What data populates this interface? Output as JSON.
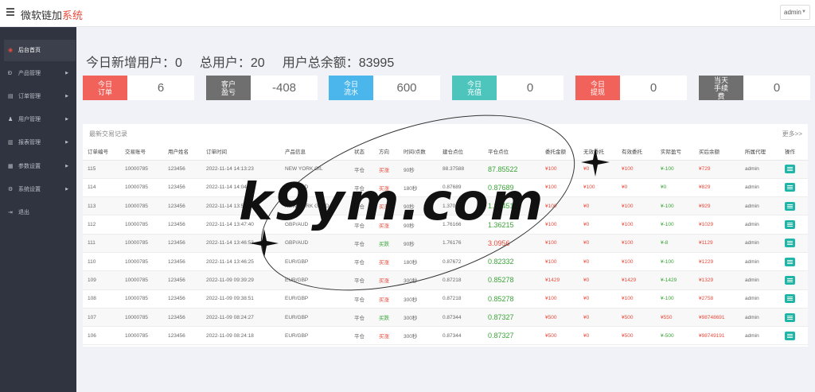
{
  "app": {
    "brand_main": "微软链加",
    "brand_accent": "系统",
    "user_menu": "admin"
  },
  "sidebar": {
    "items": [
      {
        "label": "后台首页",
        "icon": "dashboard-icon",
        "active": true
      },
      {
        "label": "产品管理",
        "icon": "product-icon"
      },
      {
        "label": "订单管理",
        "icon": "order-icon"
      },
      {
        "label": "用户管理",
        "icon": "user-icon"
      },
      {
        "label": "报表管理",
        "icon": "report-icon"
      },
      {
        "label": "参数设置",
        "icon": "settings-icon"
      },
      {
        "label": "系统设置",
        "icon": "gear-icon"
      },
      {
        "label": "退出",
        "icon": "logout-icon"
      }
    ]
  },
  "summary": {
    "new_users": "今日新增用户：0",
    "total_users": "总用户：20",
    "total_balance": "用户总余额：83995"
  },
  "stats": [
    {
      "label": "今日订单",
      "value": "6",
      "color": "#f0625a"
    },
    {
      "label": "客户盈亏",
      "value": "-408",
      "color": "#6f6f6f"
    },
    {
      "label": "今日流水",
      "value": "600",
      "color": "#4ab6ec"
    },
    {
      "label": "今日充值",
      "value": "0",
      "color": "#4dc5bd"
    },
    {
      "label": "今日提现",
      "value": "0",
      "color": "#f0625a"
    },
    {
      "label": "当天手续费",
      "value": "0",
      "color": "#6f6f6f"
    }
  ],
  "panel": {
    "title": "最新交易记录",
    "more": "更多>>"
  },
  "table": {
    "headers": [
      "订单编号",
      "交易账号",
      "用户姓名",
      "订单时间",
      "产品信息",
      "状态",
      "方向",
      "时间/点数",
      "建仓点位",
      "平仓点位",
      "委托金额",
      "无效委托",
      "有效委托",
      "实际盈亏",
      "买后余额",
      "所属代理",
      "操作"
    ],
    "rows": [
      [
        "115",
        "10000785",
        "123456",
        "2022-11-14 14:13:23",
        "NEW YORK OIL",
        "平仓",
        "买涨",
        "90秒",
        "88.37588",
        "87.85522",
        "¥100",
        "¥0",
        "¥100",
        "¥-100",
        "¥729",
        "admin"
      ],
      [
        "114",
        "10000785",
        "123456",
        "2022-11-14 14:04:33",
        "GBP/AUD",
        "平仓",
        "买涨",
        "180秒",
        "0.87689",
        "0.87689",
        "¥100",
        "¥100",
        "¥0",
        "¥0",
        "¥829",
        "admin"
      ],
      [
        "113",
        "10000785",
        "123456",
        "2022-11-14 13:51:20",
        "NEW YORK GOLD",
        "平仓",
        "买涨",
        "90秒",
        "1.37011",
        "1.37451",
        "¥100",
        "¥0",
        "¥100",
        "¥-100",
        "¥929",
        "admin"
      ],
      [
        "112",
        "10000785",
        "123456",
        "2022-11-14 13:47:40",
        "GBP/AUD",
        "平仓",
        "买涨",
        "90秒",
        "1.76166",
        "1.36215",
        "¥100",
        "¥0",
        "¥100",
        "¥-100",
        "¥1029",
        "admin"
      ],
      [
        "111",
        "10000785",
        "123456",
        "2022-11-14 13:46:53",
        "GBP/AUD",
        "平仓",
        "买跌",
        "90秒",
        "1.76176",
        "3.0956",
        "¥100",
        "¥0",
        "¥100",
        "¥-8",
        "¥1129",
        "admin"
      ],
      [
        "110",
        "10000785",
        "123456",
        "2022-11-14 13:46:25",
        "EUR/GBP",
        "平仓",
        "买涨",
        "180秒",
        "0.87672",
        "0.82332",
        "¥100",
        "¥0",
        "¥100",
        "¥-100",
        "¥1229",
        "admin"
      ],
      [
        "109",
        "10000785",
        "123456",
        "2022-11-09 09:39:29",
        "EUR/GBP",
        "平仓",
        "买涨",
        "300秒",
        "0.87218",
        "0.85278",
        "¥1429",
        "¥0",
        "¥1429",
        "¥-1429",
        "¥1329",
        "admin"
      ],
      [
        "108",
        "10000785",
        "123456",
        "2022-11-09 09:38:51",
        "EUR/GBP",
        "平仓",
        "买涨",
        "300秒",
        "0.87218",
        "0.85278",
        "¥100",
        "¥0",
        "¥100",
        "¥-100",
        "¥2758",
        "admin"
      ],
      [
        "107",
        "10000785",
        "123456",
        "2022-11-09 08:24:27",
        "EUR/GBP",
        "平仓",
        "买跌",
        "300秒",
        "0.87344",
        "0.87327",
        "¥500",
        "¥0",
        "¥500",
        "¥550",
        "¥98748691",
        "admin"
      ],
      [
        "106",
        "10000785",
        "123456",
        "2022-11-09 08:24:18",
        "EUR/GBP",
        "平仓",
        "买涨",
        "300秒",
        "0.87344",
        "0.87327",
        "¥500",
        "¥0",
        "¥500",
        "¥-500",
        "¥98749191",
        "admin"
      ]
    ]
  },
  "watermark": "k9ym.com",
  "colors": {
    "red": "#e84b3c",
    "green": "#3aa538",
    "teal": "#1fb5a8"
  }
}
